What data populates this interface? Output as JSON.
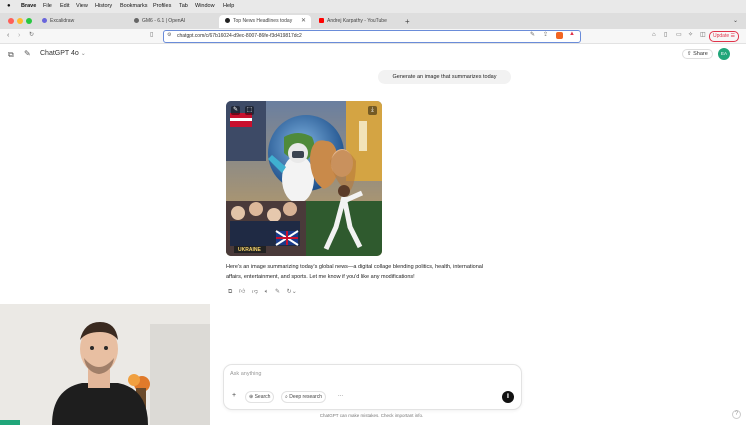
{
  "menubar": {
    "app": "Brave",
    "items": [
      "File",
      "Edit",
      "View",
      "History",
      "Bookmarks",
      "Profiles",
      "Tab",
      "Window",
      "Help"
    ]
  },
  "tabs": [
    {
      "label": "Excalidraw",
      "active": false
    },
    {
      "label": "GM6 - 6.1 | OpenAI",
      "active": false
    },
    {
      "label": "Top News Headlines today",
      "active": true
    },
    {
      "label": "Andrej Karpathy - YouTube",
      "active": false
    }
  ],
  "address_bar": {
    "url": "chatgpt.com/c/67b16024-d9ec-8007-86fe-f3d419817dc2"
  },
  "toolbar": {
    "update_label": "Update"
  },
  "chat": {
    "model_label": "ChatGPT 4o",
    "share_label": "Share",
    "avatar_initials": "EA",
    "user_message": "Generate an image that summarizes today",
    "image_caption": "UKRAINE",
    "reply_text": "Here's an image summarizing today's global news—a digital collage blending politics, health, international affairs, entertainment, and sports. Let me know if you'd like any modifications!"
  },
  "composer": {
    "placeholder": "Ask anything",
    "search_label": "Search",
    "deep_research_label": "Deep research",
    "disclaimer": "ChatGPT can make mistakes. Check important info."
  },
  "colors": {
    "accent_blue": "#6a8cd9",
    "avatar_green": "#21a67a",
    "bubble_gray": "#f2f2f2"
  }
}
